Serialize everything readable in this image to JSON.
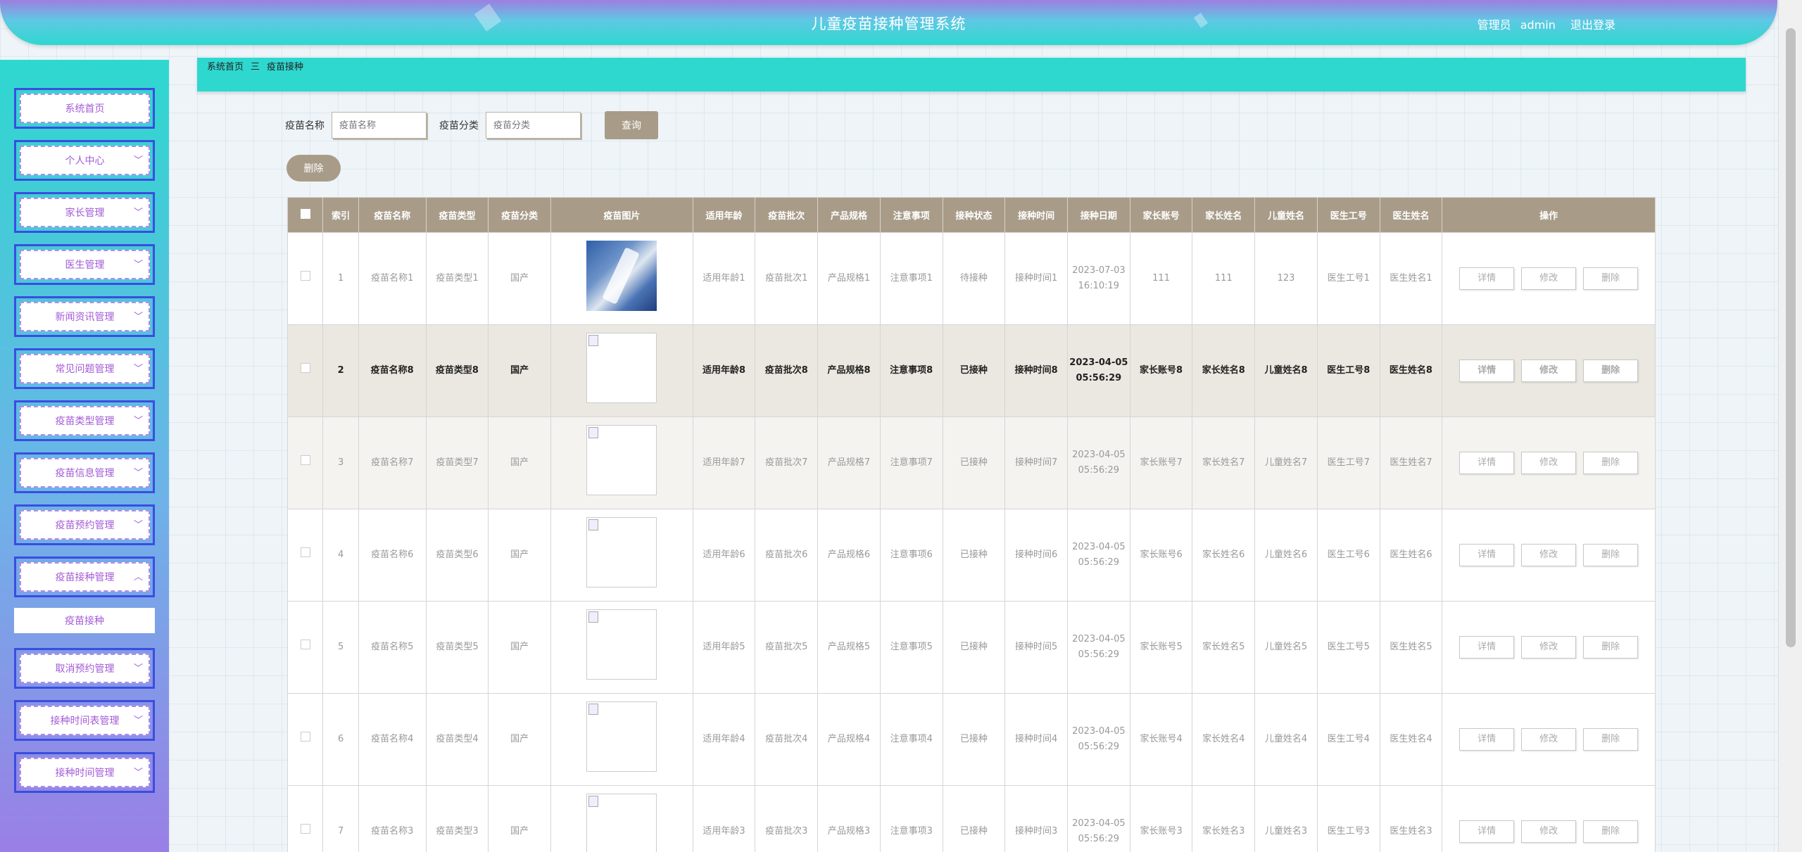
{
  "header": {
    "title": "儿童疫苗接种管理系统",
    "role": "管理员",
    "user": "admin",
    "logout": "退出登录"
  },
  "sidebar": {
    "items": [
      {
        "label": "系统首页"
      },
      {
        "label": "个人中心"
      },
      {
        "label": "家长管理"
      },
      {
        "label": "医生管理"
      },
      {
        "label": "新闻资讯管理"
      },
      {
        "label": "常见问题管理"
      },
      {
        "label": "疫苗类型管理"
      },
      {
        "label": "疫苗信息管理"
      },
      {
        "label": "疫苗预约管理"
      },
      {
        "label": "疫苗接种管理"
      },
      {
        "label": "取消预约管理"
      },
      {
        "label": "接种时间表管理"
      },
      {
        "label": "接种时间管理"
      }
    ],
    "sub_item": "疫苗接种"
  },
  "breadcrumb": {
    "home": "系统首页",
    "sep": "三",
    "current": "疫苗接种"
  },
  "search": {
    "name_label": "疫苗名称",
    "name_placeholder": "疫苗名称",
    "cat_label": "疫苗分类",
    "cat_placeholder": "疫苗分类",
    "query_btn": "查询",
    "delete_btn": "删除"
  },
  "table": {
    "headers": [
      "索引",
      "疫苗名称",
      "疫苗类型",
      "疫苗分类",
      "疫苗图片",
      "适用年龄",
      "疫苗批次",
      "产品规格",
      "注意事项",
      "接种状态",
      "接种时间",
      "接种日期",
      "家长账号",
      "家长姓名",
      "儿童姓名",
      "医生工号",
      "医生姓名",
      "操作"
    ],
    "ops": [
      "详情",
      "修改",
      "删除"
    ],
    "rows": [
      {
        "idx": "1",
        "name": "疫苗名称1",
        "type": "疫苗类型1",
        "cat": "国产",
        "age": "适用年龄1",
        "batch": "疫苗批次1",
        "spec": "产品规格1",
        "note": "注意事项1",
        "status": "待接种",
        "time": "接种时间1",
        "date": "2023-07-03 16:10:19",
        "pacct": "111",
        "pname": "111",
        "child": "123",
        "docid": "医生工号1",
        "docname": "医生姓名1"
      },
      {
        "idx": "2",
        "name": "疫苗名称8",
        "type": "疫苗类型8",
        "cat": "国产",
        "age": "适用年龄8",
        "batch": "疫苗批次8",
        "spec": "产品规格8",
        "note": "注意事项8",
        "status": "已接种",
        "time": "接种时间8",
        "date": "2023-04-05 05:56:29",
        "pacct": "家长账号8",
        "pname": "家长姓名8",
        "child": "儿童姓名8",
        "docid": "医生工号8",
        "docname": "医生姓名8"
      },
      {
        "idx": "3",
        "name": "疫苗名称7",
        "type": "疫苗类型7",
        "cat": "国产",
        "age": "适用年龄7",
        "batch": "疫苗批次7",
        "spec": "产品规格7",
        "note": "注意事项7",
        "status": "已接种",
        "time": "接种时间7",
        "date": "2023-04-05 05:56:29",
        "pacct": "家长账号7",
        "pname": "家长姓名7",
        "child": "儿童姓名7",
        "docid": "医生工号7",
        "docname": "医生姓名7"
      },
      {
        "idx": "4",
        "name": "疫苗名称6",
        "type": "疫苗类型6",
        "cat": "国产",
        "age": "适用年龄6",
        "batch": "疫苗批次6",
        "spec": "产品规格6",
        "note": "注意事项6",
        "status": "已接种",
        "time": "接种时间6",
        "date": "2023-04-05 05:56:29",
        "pacct": "家长账号6",
        "pname": "家长姓名6",
        "child": "儿童姓名6",
        "docid": "医生工号6",
        "docname": "医生姓名6"
      },
      {
        "idx": "5",
        "name": "疫苗名称5",
        "type": "疫苗类型5",
        "cat": "国产",
        "age": "适用年龄5",
        "batch": "疫苗批次5",
        "spec": "产品规格5",
        "note": "注意事项5",
        "status": "已接种",
        "time": "接种时间5",
        "date": "2023-04-05 05:56:29",
        "pacct": "家长账号5",
        "pname": "家长姓名5",
        "child": "儿童姓名5",
        "docid": "医生工号5",
        "docname": "医生姓名5"
      },
      {
        "idx": "6",
        "name": "疫苗名称4",
        "type": "疫苗类型4",
        "cat": "国产",
        "age": "适用年龄4",
        "batch": "疫苗批次4",
        "spec": "产品规格4",
        "note": "注意事项4",
        "status": "已接种",
        "time": "接种时间4",
        "date": "2023-04-05 05:56:29",
        "pacct": "家长账号4",
        "pname": "家长姓名4",
        "child": "儿童姓名4",
        "docid": "医生工号4",
        "docname": "医生姓名4"
      },
      {
        "idx": "7",
        "name": "疫苗名称3",
        "type": "疫苗类型3",
        "cat": "国产",
        "age": "适用年龄3",
        "batch": "疫苗批次3",
        "spec": "产品规格3",
        "note": "注意事项3",
        "status": "已接种",
        "time": "接种时间3",
        "date": "2023-04-05 05:56:29",
        "pacct": "家长账号3",
        "pname": "家长姓名3",
        "child": "儿童姓名3",
        "docid": "医生工号3",
        "docname": "医生姓名3"
      }
    ]
  },
  "colors": {
    "accent": "#2ed8cf",
    "header_purple": "#9c7fe0",
    "table_head": "#a89c89",
    "menu_text": "#a35bd6"
  }
}
